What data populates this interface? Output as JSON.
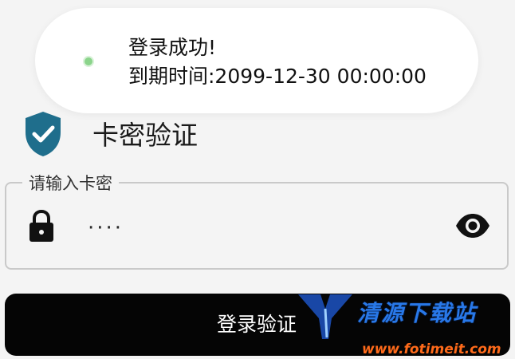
{
  "toast": {
    "title": "登录成功!",
    "expiry": "到期时间:2099-12-30 00:00:00",
    "icon": "app-icon"
  },
  "header": {
    "title": "卡密验证",
    "icon": "shield-check-icon",
    "icon_color": "#1f6e8c"
  },
  "card_key_field": {
    "label": "请输入卡密",
    "value": "····",
    "leading_icon": "lock-icon",
    "trailing_icon": "eye-icon"
  },
  "login_button": {
    "label": "登录验证",
    "background": "#050505"
  },
  "watermark": {
    "site_name": "清源下载站",
    "url": "www.fotimeit.com"
  }
}
